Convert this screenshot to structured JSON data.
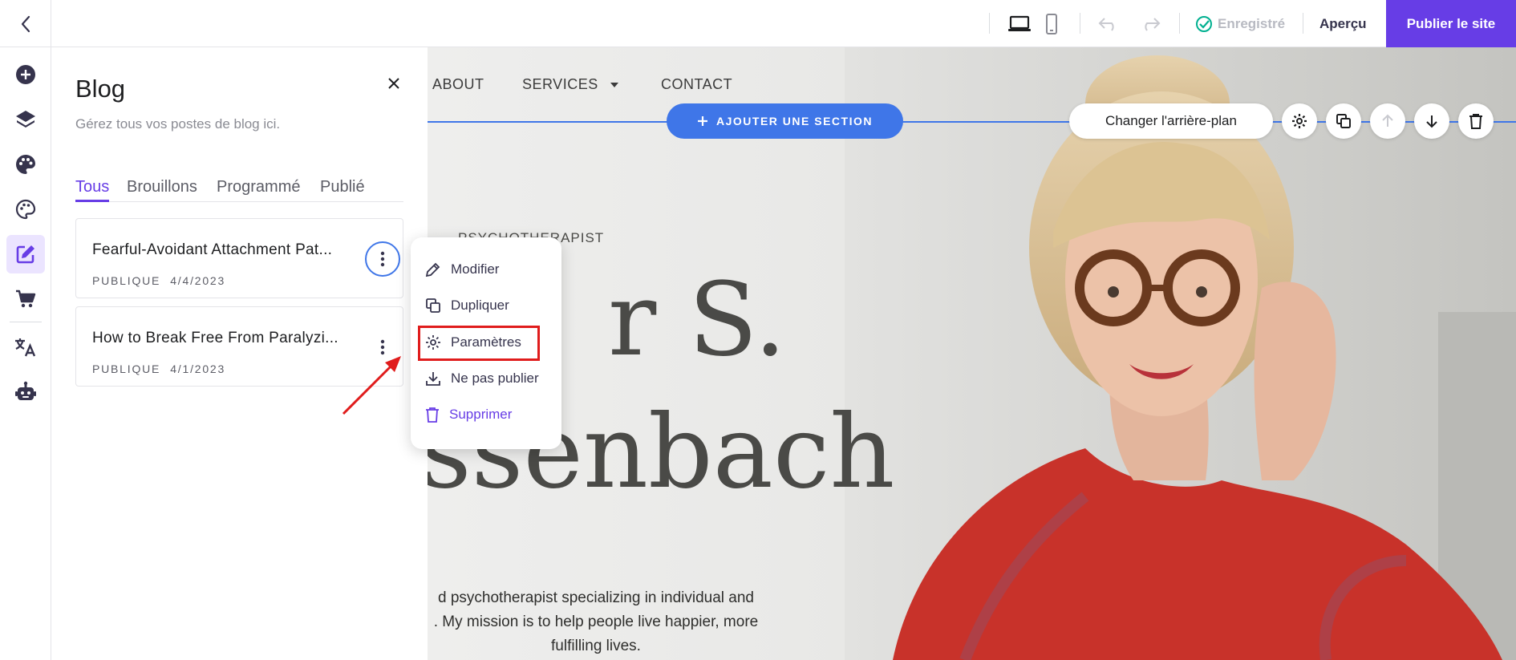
{
  "topbar": {
    "saved_label": "Enregistré",
    "preview_label": "Aperçu",
    "publish_label": "Publier le site",
    "accent_color": "#673de6"
  },
  "rail": {
    "icons": [
      "add-element-icon",
      "layers-icon",
      "palette-icon",
      "theme-icon",
      "blog-edit-icon",
      "cart-icon",
      "translate-icon",
      "ai-robot-icon"
    ]
  },
  "blog_panel": {
    "title": "Blog",
    "subtitle": "Gérez tous vos postes de blog ici.",
    "tabs": [
      "Tous",
      "Brouillons",
      "Programmé",
      "Publié"
    ],
    "posts": [
      {
        "title": "Fearful-Avoidant Attachment Pat...",
        "status": "PUBLIQUE",
        "date": "4/4/2023"
      },
      {
        "title": "How to Break Free From Paralyzi...",
        "status": "PUBLIQUE",
        "date": "4/1/2023"
      }
    ]
  },
  "context_menu": {
    "items": [
      "Modifier",
      "Dupliquer",
      "Paramètres",
      "Ne pas publier",
      "Supprimer"
    ]
  },
  "canvas": {
    "nav": [
      "ABOUT",
      "SERVICES",
      "CONTACT"
    ],
    "add_section_label": "AJOUTER UNE SECTION",
    "change_bg_label": "Changer l'arrière-plan",
    "hero_label": "PSYCHOTHERAPIST",
    "hero_name_line1": "r S.",
    "hero_name_line2": "ssenbach",
    "hero_desc_1": "d psychotherapist specializing in individual and",
    "hero_desc_2": ". My mission is to help people live happier, more",
    "hero_desc_3": "fulfilling lives."
  }
}
